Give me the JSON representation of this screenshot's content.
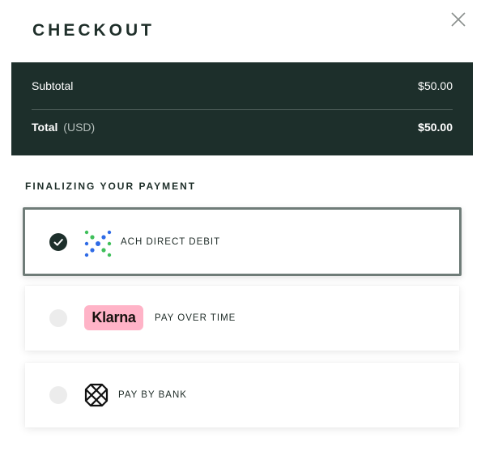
{
  "header": {
    "title": "CHECKOUT",
    "close_icon": "close-icon"
  },
  "summary": {
    "subtotal_label": "Subtotal",
    "subtotal_value": "$50.00",
    "total_label": "Total",
    "total_currency": "(USD)",
    "total_value": "$50.00",
    "background_color": "#1d2f2b"
  },
  "payment": {
    "section_title": "FINALIZING YOUR PAYMENT",
    "options": [
      {
        "label": "ACH DIRECT DEBIT",
        "selected": true,
        "icon": "ach-logo-icon"
      },
      {
        "label": "PAY OVER TIME",
        "selected": false,
        "icon": "klarna-logo-icon",
        "logo_text": "Klarna"
      },
      {
        "label": "PAY BY BANK",
        "selected": false,
        "icon": "plaid-logo-icon"
      }
    ],
    "selected_border_color": "#6f7c78",
    "klarna_pink": "#ffb3c7"
  }
}
